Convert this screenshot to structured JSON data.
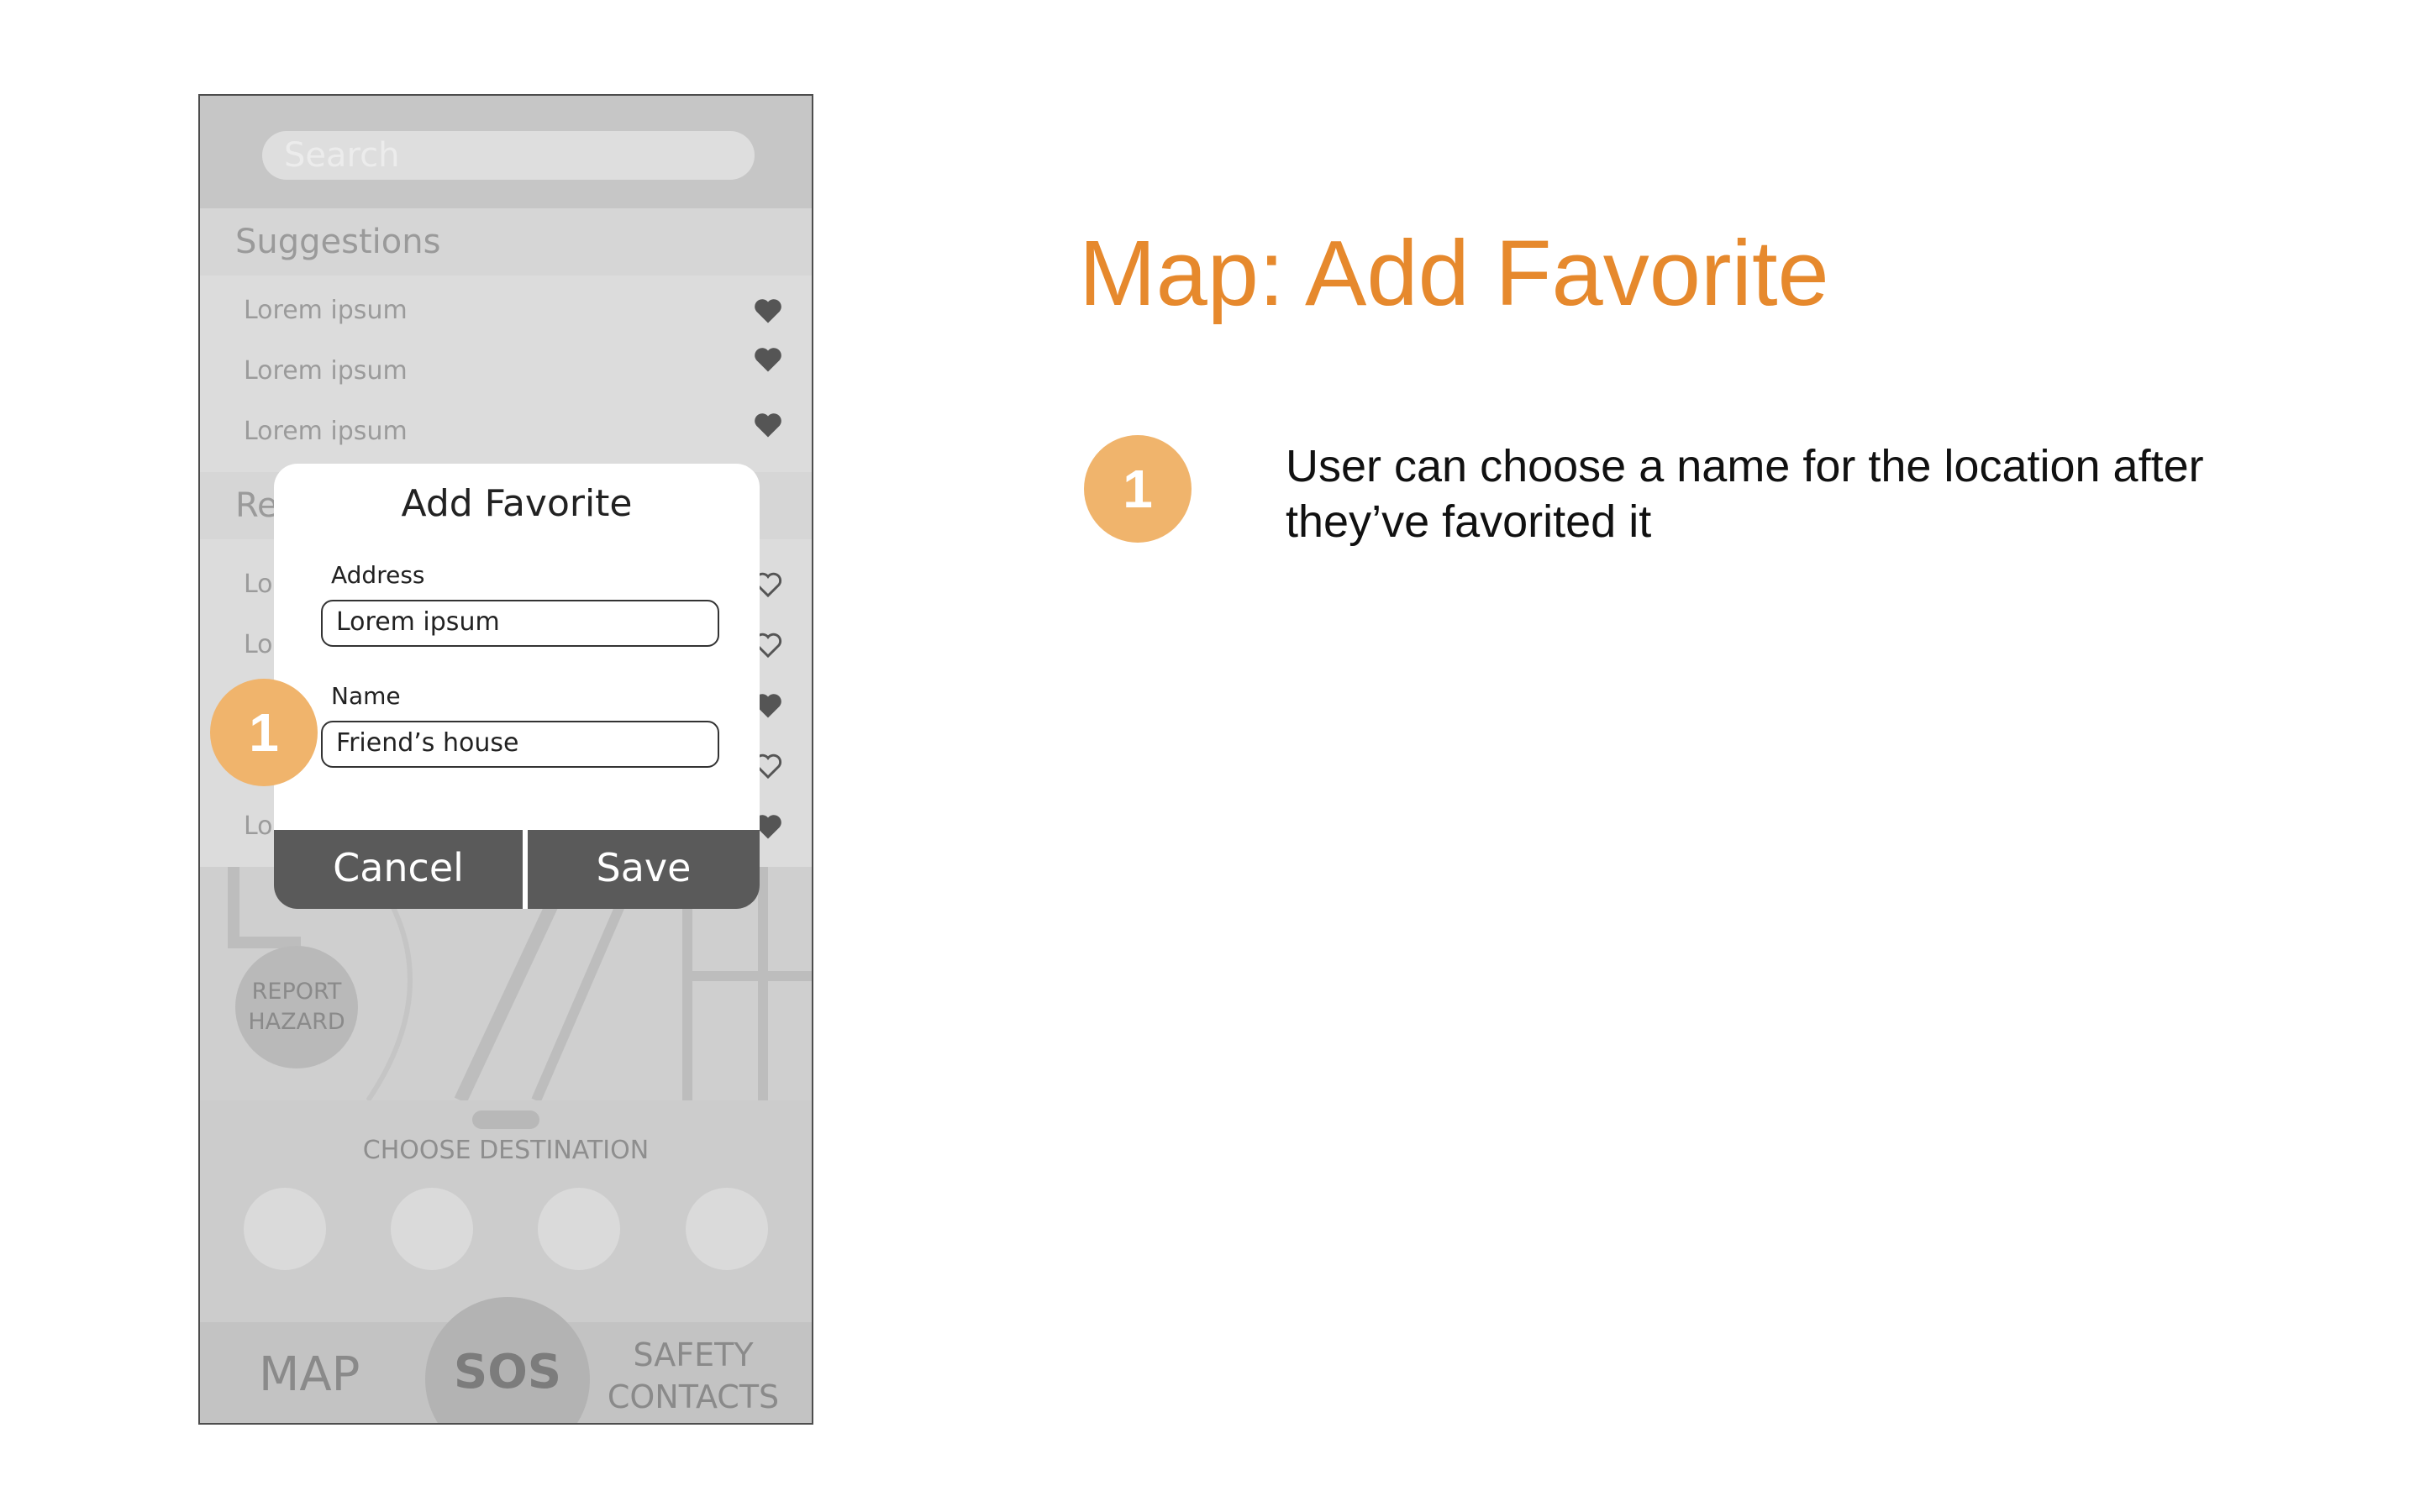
{
  "slide": {
    "title": "Map: Add Favorite",
    "callout_number": "1",
    "note": "User can choose a name for the location after they’ve favorited it",
    "accent_color": "#e6892d",
    "badge_color": "#f0b46c"
  },
  "phone": {
    "search": {
      "placeholder": "Search"
    },
    "suggestions": {
      "header": "Suggestions",
      "items": [
        {
          "label": "Lorem ipsum",
          "favorite": "filled"
        },
        {
          "label": "Lorem ipsum",
          "favorite": "filled"
        },
        {
          "label": "Lorem ipsum",
          "favorite": "filled"
        }
      ]
    },
    "recent": {
      "header": "Re",
      "items": [
        {
          "label": "Lo",
          "favorite": "outline"
        },
        {
          "label": "Lo",
          "favorite": "outline"
        },
        {
          "label": "",
          "favorite": "filled"
        },
        {
          "label": "",
          "favorite": "outline"
        },
        {
          "label": "Lo",
          "favorite": "filled"
        }
      ]
    },
    "report_hazard": {
      "line1": "REPORT",
      "line2": "HAZARD"
    },
    "choose_destination": "CHOOSE DESTINATION",
    "tabs": {
      "map": "MAP",
      "sos": "SOS",
      "safety_line1": "SAFETY",
      "safety_line2": "CONTACTS"
    }
  },
  "modal": {
    "title": "Add Favorite",
    "address_label": "Address",
    "address_value": "Lorem ipsum",
    "name_label": "Name",
    "name_value": "Friend’s house",
    "cancel": "Cancel",
    "save": "Save"
  }
}
